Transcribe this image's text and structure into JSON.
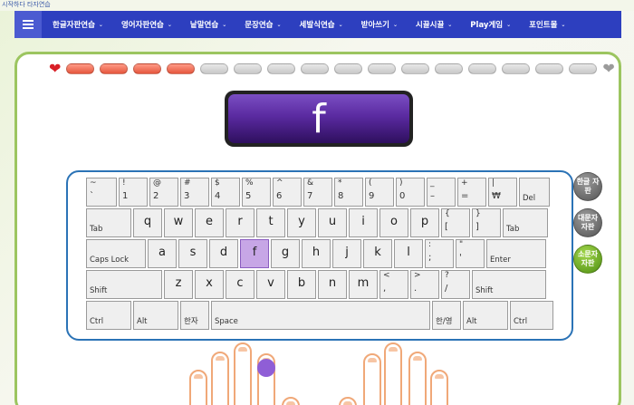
{
  "corner_text": "시작하다 타자연습",
  "nav": {
    "items": [
      {
        "label": "한글자판연습"
      },
      {
        "label": "영어자판연습"
      },
      {
        "label": "낱말연습"
      },
      {
        "label": "문장연습"
      },
      {
        "label": "세발식연습"
      },
      {
        "label": "받아쓰기"
      },
      {
        "label": "시끌시끌"
      },
      {
        "label": "Play게임"
      },
      {
        "label": "포인트몰"
      }
    ]
  },
  "progress": {
    "completed": 4,
    "total": 16
  },
  "current_char": "f",
  "keyboard": {
    "number_row": [
      {
        "top": "~",
        "bottom": "`"
      },
      {
        "top": "!",
        "bottom": "1"
      },
      {
        "top": "@",
        "bottom": "2"
      },
      {
        "top": "#",
        "bottom": "3"
      },
      {
        "top": "$",
        "bottom": "4"
      },
      {
        "top": "%",
        "bottom": "5"
      },
      {
        "top": "^",
        "bottom": "6"
      },
      {
        "top": "&",
        "bottom": "7"
      },
      {
        "top": "*",
        "bottom": "8"
      },
      {
        "top": "(",
        "bottom": "9"
      },
      {
        "top": ")",
        "bottom": "0"
      },
      {
        "top": "_",
        "bottom": "–"
      },
      {
        "top": "+",
        "bottom": "="
      },
      {
        "top": "|",
        "bottom": "₩"
      },
      {
        "label": "Del"
      }
    ],
    "tab": "Tab",
    "qwerty": [
      "q",
      "w",
      "e",
      "r",
      "t",
      "y",
      "u",
      "i",
      "o",
      "p"
    ],
    "brackets": [
      {
        "top": "{",
        "bottom": "["
      },
      {
        "top": "}",
        "bottom": "]"
      }
    ],
    "tab_right": "Tab",
    "caps": "Caps Lock",
    "home": [
      "a",
      "s",
      "d",
      "f",
      "g",
      "h",
      "j",
      "k",
      "l"
    ],
    "home_punct": [
      {
        "top": ":",
        "bottom": ";"
      },
      {
        "top": "\"",
        "bottom": "'"
      }
    ],
    "enter": "Enter",
    "shift": "Shift",
    "bottom_letters": [
      "z",
      "x",
      "c",
      "v",
      "b",
      "n",
      "m"
    ],
    "bottom_punct": [
      {
        "top": "<",
        "bottom": ","
      },
      {
        "top": ">",
        "bottom": "."
      },
      {
        "top": "?",
        "bottom": "/"
      }
    ],
    "shift_right": "Shift",
    "ctrl": "Ctrl",
    "alt": "Alt",
    "hanja": "한자",
    "space": "Space",
    "hanyoung": "한/영",
    "alt_right": "Alt",
    "ctrl_right": "Ctrl",
    "active_key": "f"
  },
  "side_buttons": [
    {
      "label": "한글 자판",
      "color": "gray"
    },
    {
      "label": "대문자 자판",
      "color": "gray"
    },
    {
      "label": "소문자 자판",
      "color": "green"
    }
  ],
  "colors": {
    "nav_bg": "#2d3fbf",
    "panel_border": "#9cc560",
    "keyboard_border": "#2b73b6",
    "active_key": "#c7a6e6",
    "char_bg": "#5a2aa0"
  }
}
